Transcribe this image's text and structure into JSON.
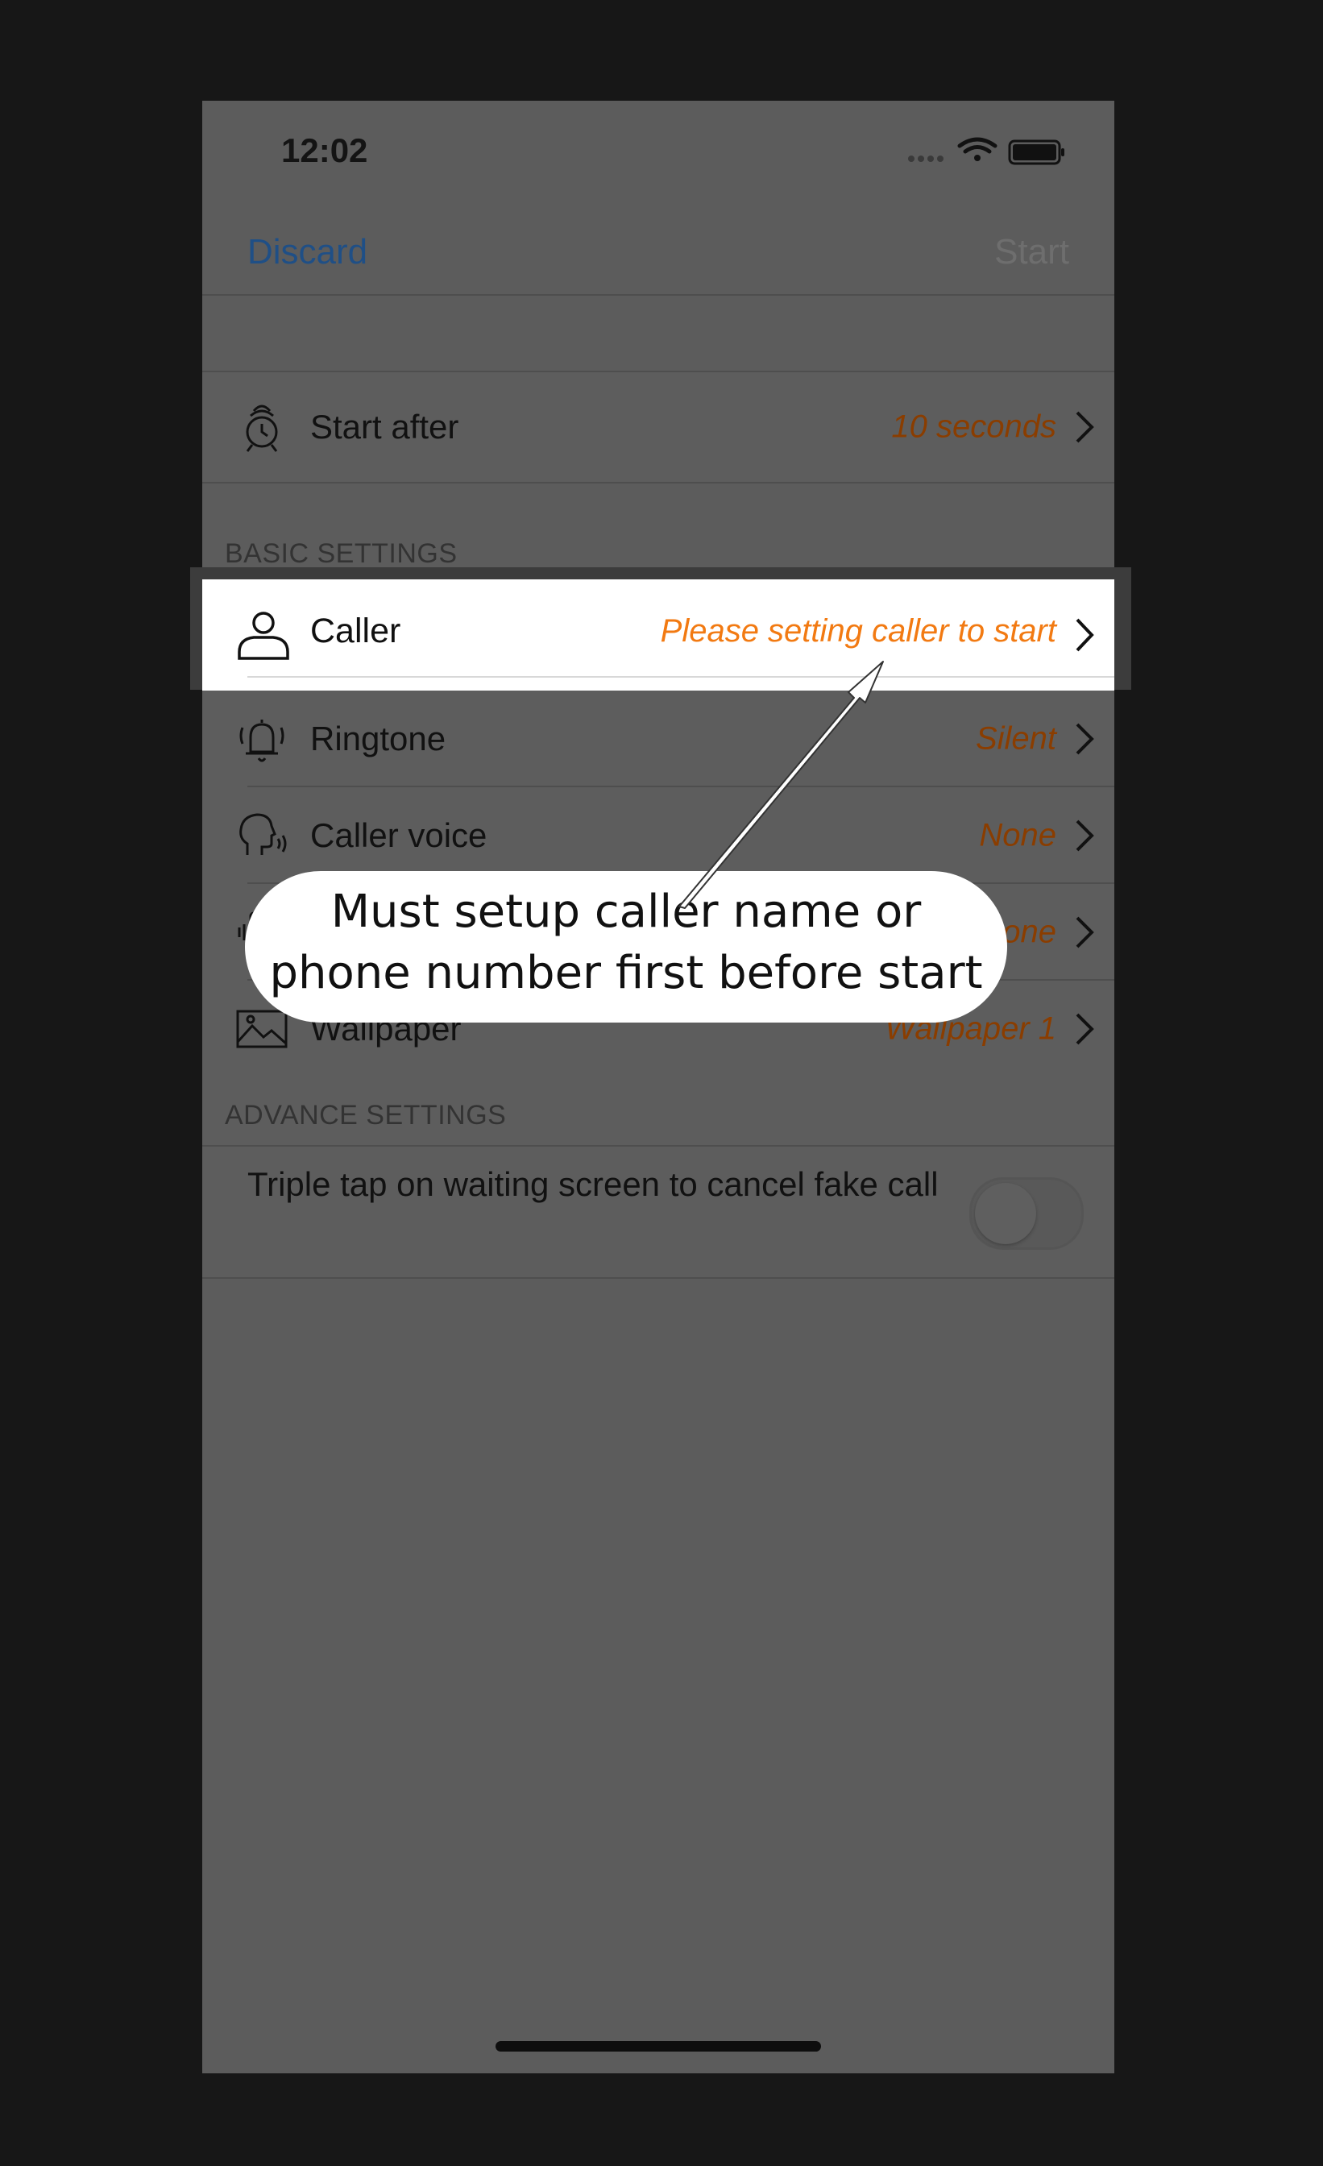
{
  "status_bar": {
    "time": "12:02",
    "icons": [
      "signal-icon",
      "wifi-icon",
      "battery-icon"
    ]
  },
  "nav": {
    "left": "Discard",
    "right": "Start"
  },
  "start_after": {
    "label": "Start after",
    "value": "10 seconds"
  },
  "sections": {
    "basic": "BASIC SETTINGS",
    "advance": "ADVANCE SETTINGS"
  },
  "basic_rows": [
    {
      "label": "Caller",
      "value": "Please setting caller to start"
    },
    {
      "label": "Ringtone",
      "value": "Silent"
    },
    {
      "label": "Caller voice",
      "value": "None"
    },
    {
      "label": "",
      "value": "None"
    },
    {
      "label": "Wallpaper",
      "value": "Wallpaper 1"
    }
  ],
  "advance": {
    "label": "Triple tap on waiting screen to cancel fake call",
    "toggle_on": false
  },
  "callout": {
    "line1": "Must setup caller name or",
    "line2": "phone number first before start"
  },
  "colors": {
    "accent": "#f27a12",
    "nav_link": "#1f4f86",
    "overlay_bg": "#5c5c5c"
  }
}
